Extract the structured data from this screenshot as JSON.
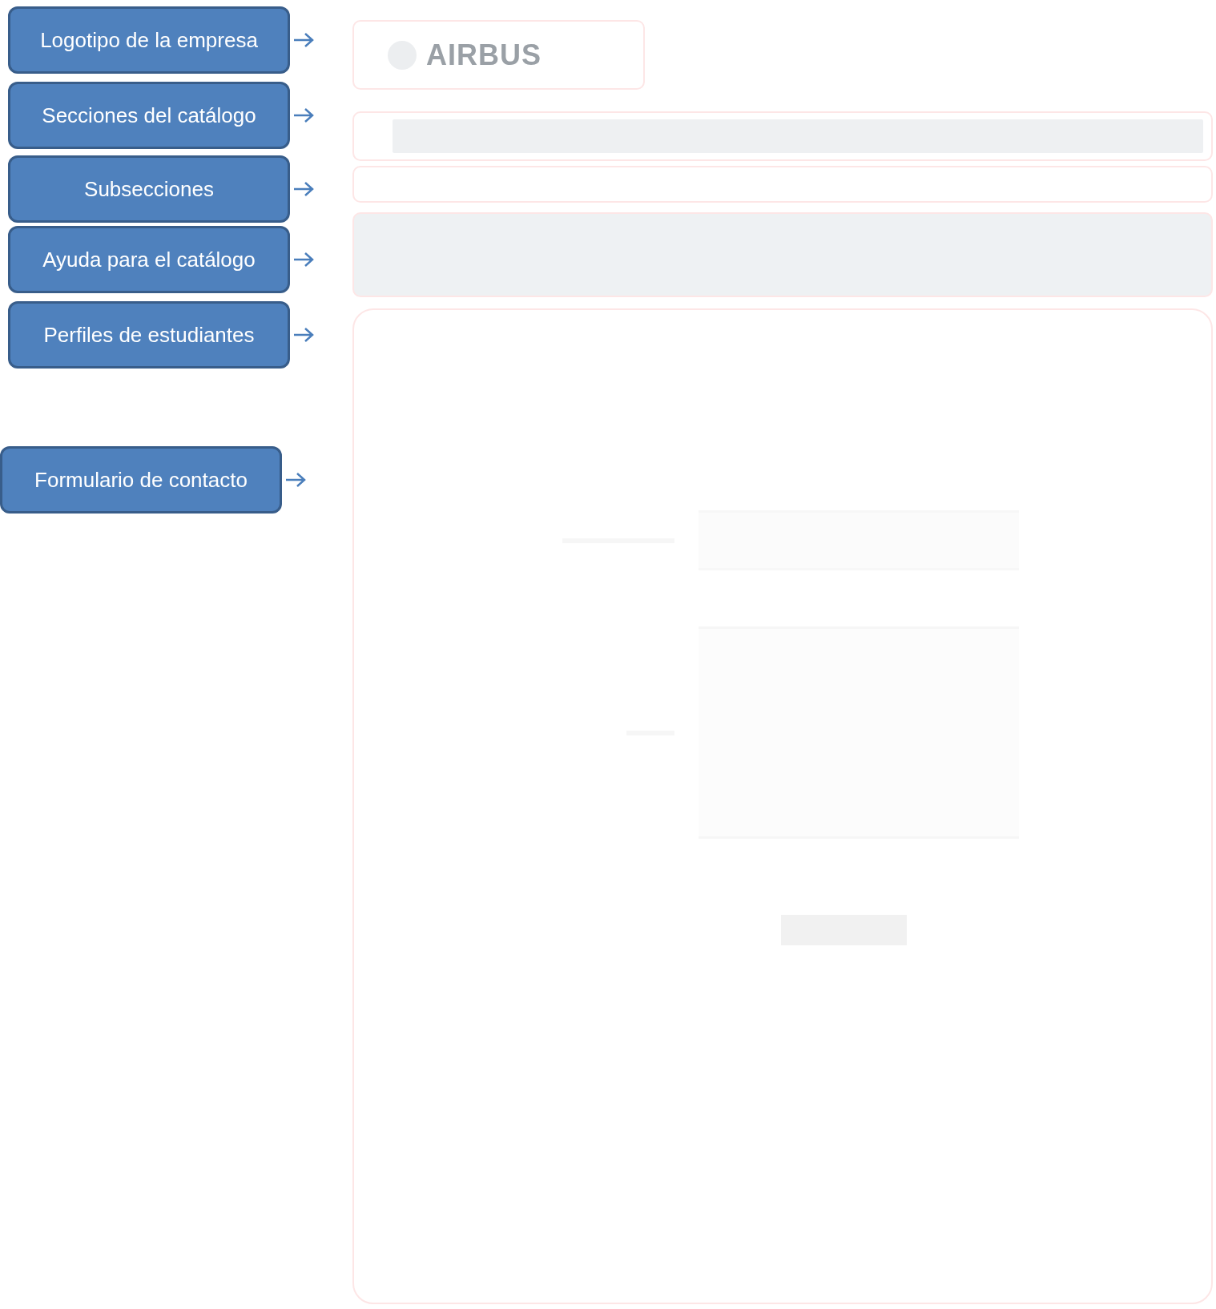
{
  "callouts": [
    {
      "label": "Logotipo de la empresa"
    },
    {
      "label": "Secciones del catálogo"
    },
    {
      "label": "Subsecciones"
    },
    {
      "label": "Ayuda para el catálogo"
    },
    {
      "label": "Perfiles de estudiantes"
    },
    {
      "label": "Formulario de contacto"
    }
  ],
  "page": {
    "logo": {
      "text": "AIRBUS"
    }
  }
}
